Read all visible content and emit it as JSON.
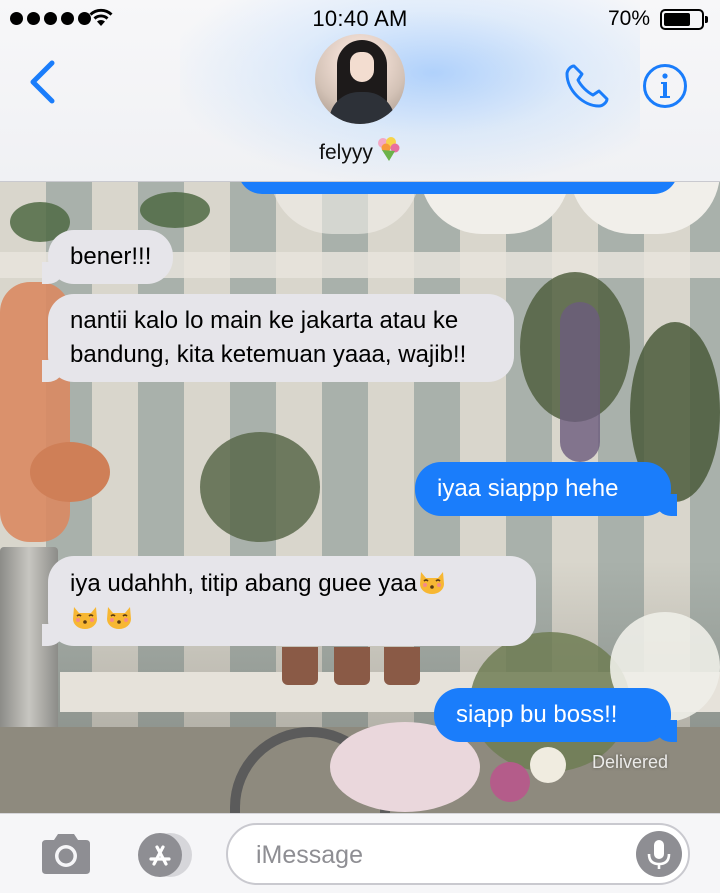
{
  "status_bar": {
    "time": "10:40 AM",
    "battery_percent": "70%",
    "battery_level": 0.7,
    "signal_bars": 5
  },
  "header": {
    "contact_name": "felyyy",
    "contact_emoji": "bouquet-emoji",
    "back_icon": "chevron-left-icon",
    "call_icon": "phone-icon",
    "info_icon": "info-icon"
  },
  "messages": [
    {
      "direction": "incoming",
      "text": "bener!!!"
    },
    {
      "direction": "incoming",
      "text": "nantii kalo lo main ke jakarta atau ke bandung, kita ketemuan yaaa, wajib!!"
    },
    {
      "direction": "outgoing",
      "text": "iyaa siappp hehe"
    },
    {
      "direction": "incoming",
      "text": "iya udahhh, titip abang guee yaa",
      "emojis": [
        "kissing-cat-emoji",
        "kissing-cat-emoji",
        "kissing-cat-emoji"
      ]
    },
    {
      "direction": "outgoing",
      "text": "siapp bu boss!!",
      "status": "Delivered"
    }
  ],
  "input_bar": {
    "placeholder": "iMessage",
    "camera_icon": "camera-icon",
    "apps_icon": "app-store-icon",
    "mic_icon": "microphone-icon"
  },
  "colors": {
    "outgoing_bubble": "#1a7dfb",
    "incoming_bubble": "#e6e5ea",
    "accent": "#1a7dfb"
  }
}
